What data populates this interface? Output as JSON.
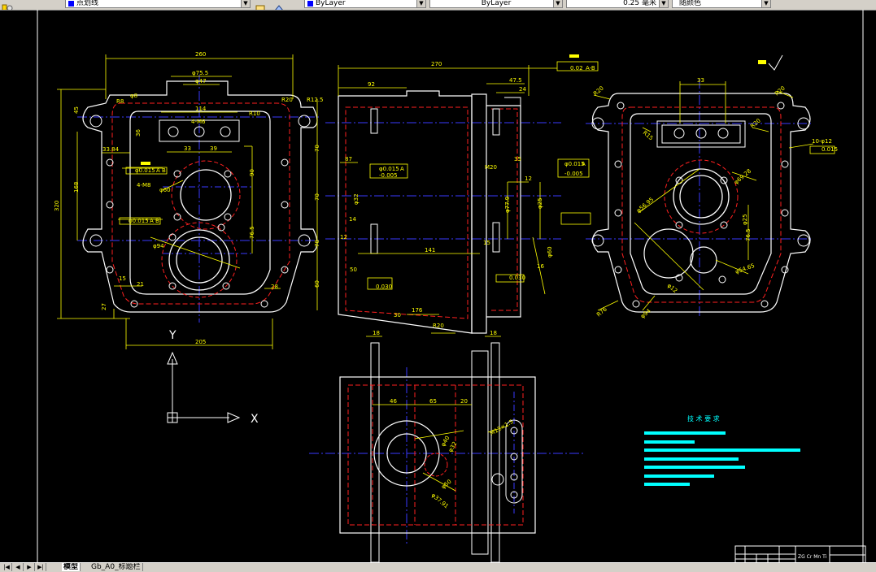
{
  "toolbar": {
    "linetype_value": "点划线",
    "layer_color_value": "ByLayer",
    "linetype2_value": "ByLayer",
    "lineweight_value": "0.25 毫米",
    "plotstyle_value": "随颜色"
  },
  "tabs": {
    "model": "模型",
    "layout": "Gb_A0_标题栏"
  },
  "drawing": {
    "front_view": {
      "dims": [
        "260",
        "φ75.5",
        "φ47",
        "114",
        "4-M6",
        "33",
        "39",
        "36",
        "33.84",
        "φ0.015",
        "A",
        "B",
        "4-M8",
        "φ0.015",
        "A",
        "B",
        "90",
        "76.5",
        "70",
        "70",
        "70",
        "60",
        "320",
        "168",
        "15",
        "21",
        "28",
        "27",
        "205",
        "45",
        "R8",
        "φ94",
        "φ60",
        "R10",
        "R20",
        "R12.5",
        "φ8"
      ],
      "axis_y": "Y",
      "axis_x": "X"
    },
    "side_view": {
      "dims": [
        "270",
        "92",
        "47.5",
        "24",
        "0.02",
        "A-B",
        "87",
        "φ0.015",
        "A",
        "-0.005",
        "φ0.015",
        "A",
        "-0.005",
        "φ77.9",
        "14",
        "35",
        "12",
        "141",
        "12",
        "15",
        "0.030",
        "R20",
        "176",
        "16",
        "0.030",
        "φ32",
        "φ25",
        "φ60",
        "30",
        "M20",
        "50"
      ]
    },
    "right_view": {
      "dims": [
        "33",
        "R20",
        "R20",
        "R15",
        "10-φ12",
        "0.015",
        "φ69.28",
        "φ56.95",
        "φ25",
        "76.5",
        "R76",
        "φ94",
        "φ54.65",
        "φ12",
        "R20"
      ]
    },
    "bottom_view": {
      "dims": [
        "18",
        "18",
        "46",
        "65",
        "20",
        "φ40",
        "φ32",
        "φ50",
        "φ37.91",
        "M12×1.5"
      ]
    },
    "tech_requirements_title": "技 术 要 求",
    "title_block_text": "ZG Cr Mn Ti"
  },
  "colors": {
    "background": "#000000",
    "outline": "#ffffff",
    "dimension": "#ffff00",
    "center": "#3a3aff",
    "hidden": "#ff2020",
    "text_bars": "#00ffff"
  }
}
